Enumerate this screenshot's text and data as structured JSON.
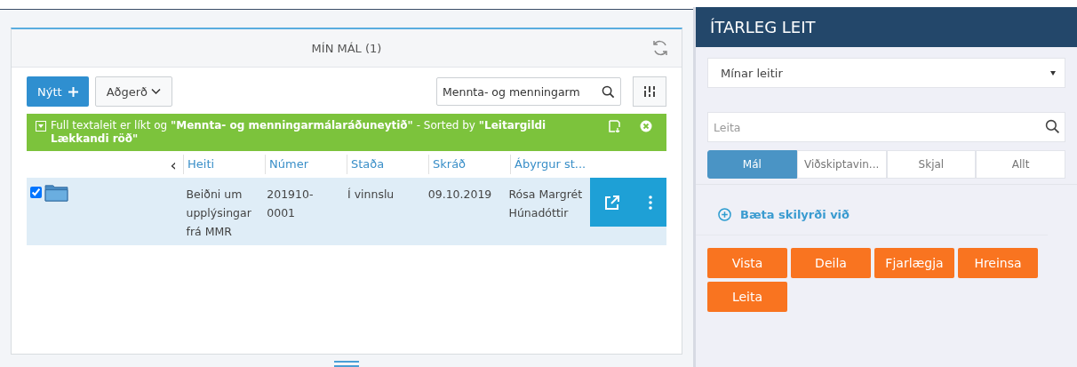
{
  "panel": {
    "title": "MÍN MÁL (1)"
  },
  "toolbar": {
    "new_button": "Nýtt",
    "action_button": "Aðgerð",
    "search": {
      "value": "Mennta- og menningarm"
    }
  },
  "filter_banner": {
    "text": "Full textaleit er líkt og **\"Mennta- og menningarmálaráðuneytið\"** - Sorted by **\"Leitargildi Lækkandi röð\"**"
  },
  "table": {
    "scroll_left": "‹",
    "columns": [
      "Heiti",
      "Númer",
      "Staða",
      "Skráð",
      "Ábyrgur st..."
    ],
    "rows": [
      {
        "checked": true,
        "cells": [
          "Beiðni um upplýsingar frá MMR",
          "201910-0001",
          "Í vinnslu",
          "09.10.2019",
          "Rósa Margrét Húnadóttir"
        ]
      }
    ]
  },
  "advanced_search": {
    "title": "ÍTARLEG LEIT",
    "saved_searches": "Mínar leitir",
    "search": {
      "placeholder": "Leita"
    },
    "tabs": [
      {
        "label": "Mál",
        "selected": true
      },
      {
        "label": "Viðskiptavin...",
        "selected": false
      },
      {
        "label": "Skjal",
        "selected": false
      },
      {
        "label": "Allt",
        "selected": false
      }
    ],
    "add_condition": "Bæta skilyrði við",
    "buttons": [
      "Vista",
      "Deila",
      "Fjarlægja",
      "Hreinsa",
      "Leita"
    ]
  }
}
